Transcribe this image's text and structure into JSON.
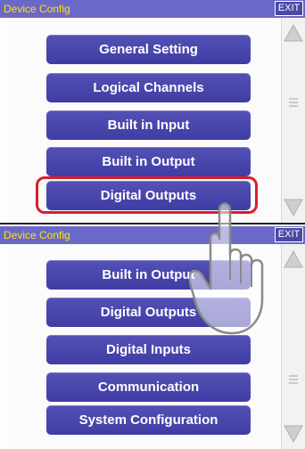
{
  "top_panel": {
    "title": "Device Config",
    "exit_label": "EXIT",
    "items": [
      "General Setting",
      "Logical Channels",
      "Built in Input",
      "Built in Output",
      "Digital Outputs"
    ]
  },
  "bottom_panel": {
    "title": "Device Config",
    "exit_label": "EXIT",
    "items": [
      "Built in Output",
      "Digital Outputs",
      "Digital Inputs",
      "Communication",
      "System Configuration"
    ]
  },
  "colors": {
    "title_bar": "#6a68c8",
    "title_text": "#ffe400",
    "button": "#4846ad",
    "highlight": "#d81e2c"
  },
  "icons": [
    "scroll-up-arrow-icon",
    "scroll-thumb-icon",
    "scroll-down-arrow-icon",
    "pointing-hand-icon"
  ]
}
